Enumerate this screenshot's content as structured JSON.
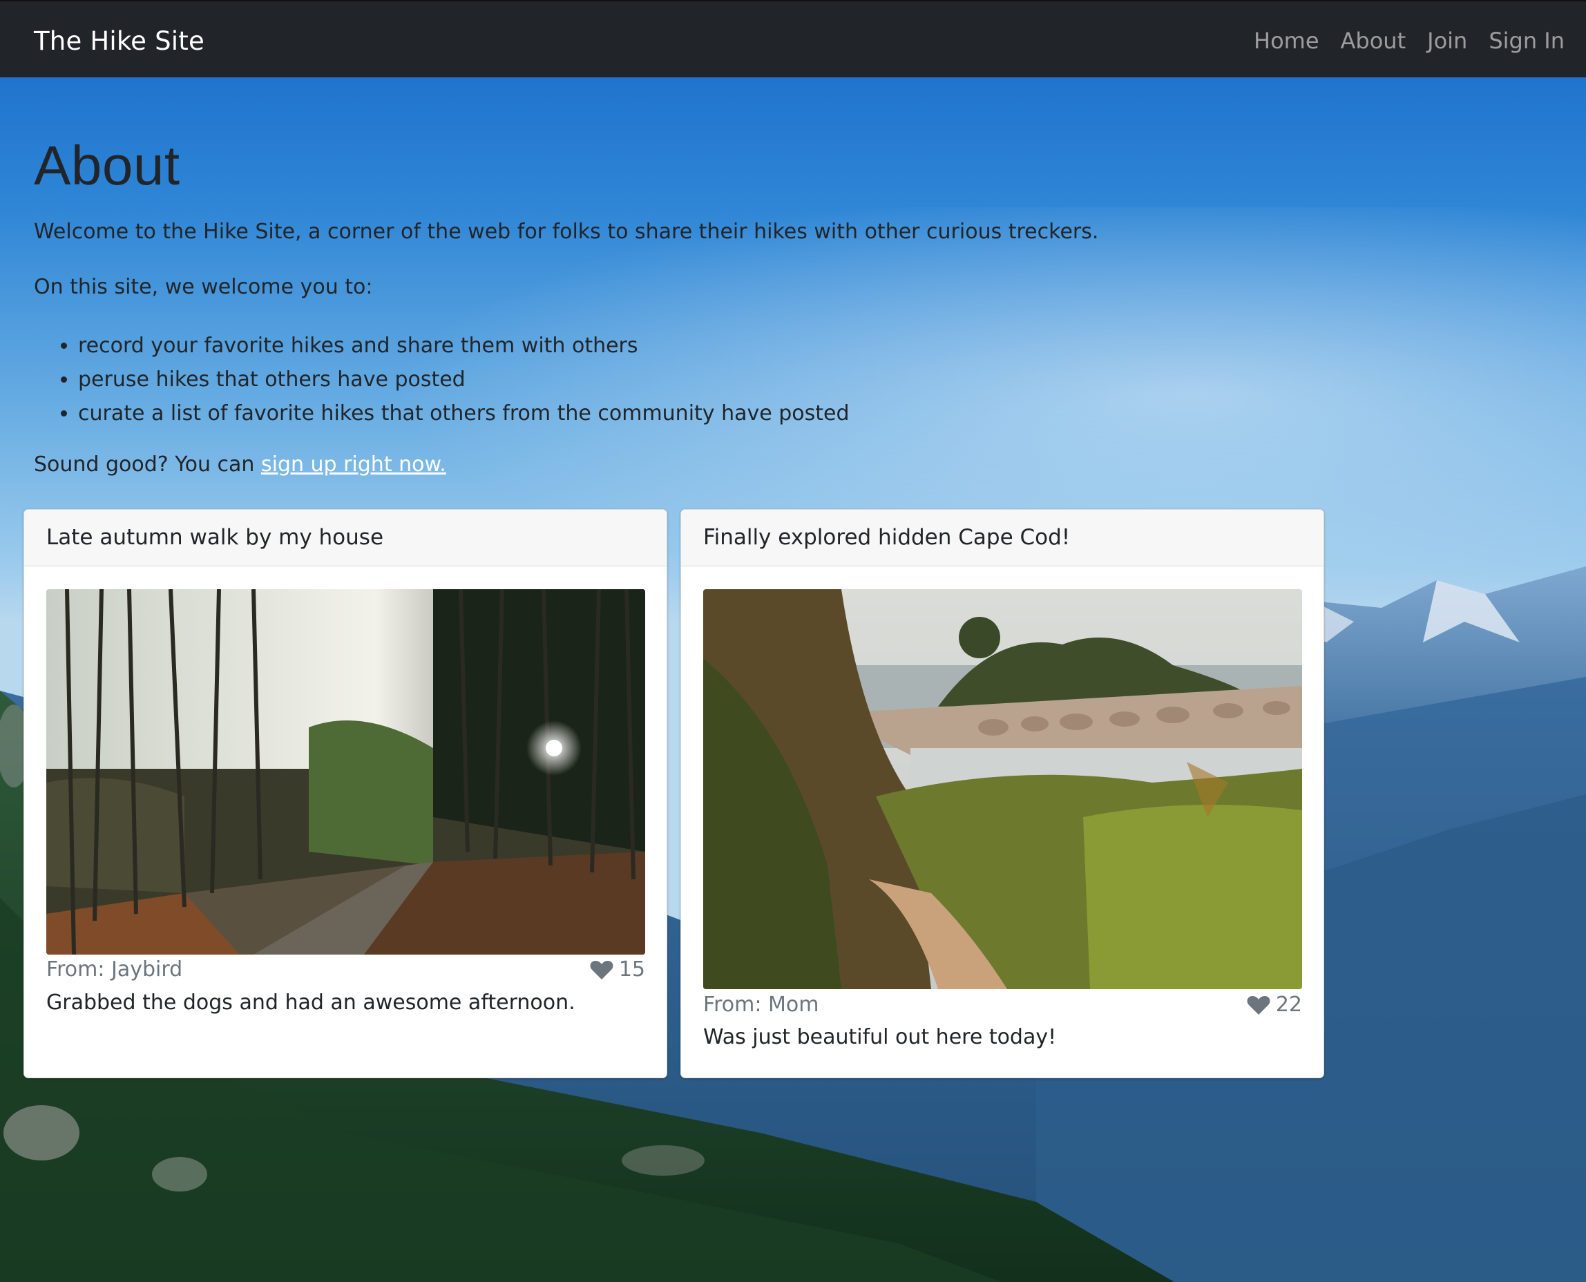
{
  "navbar": {
    "brand": "The Hike Site",
    "links": [
      "Home",
      "About",
      "Join",
      "Sign In"
    ]
  },
  "page": {
    "title": "About",
    "intro": "Welcome to the Hike Site, a corner of the web for folks to share their hikes with other curious treckers.",
    "lead": "On this site, we welcome you to:",
    "bullets": [
      "record your favorite hikes and share them with others",
      "peruse hikes that others have posted",
      "curate a list of favorite hikes that others from the community have posted"
    ],
    "cta_prefix": "Sound good? You can ",
    "cta_link": "sign up right now."
  },
  "cards": [
    {
      "title": "Late autumn walk by my house",
      "from": "From: Jaybird",
      "likes": "15",
      "text": "Grabbed the dogs and had an awesome afternoon.",
      "image": "forest-trail-photo"
    },
    {
      "title": "Finally explored hidden Cape Cod!",
      "from": "From: Mom",
      "likes": "22",
      "text": "Was just beautiful out here today!",
      "image": "coastal-trail-photo"
    }
  ],
  "icons": {
    "like": "heart-icon"
  },
  "colors": {
    "navbar": "#212529",
    "link": "#ffffff",
    "muted": "#6c757d"
  }
}
